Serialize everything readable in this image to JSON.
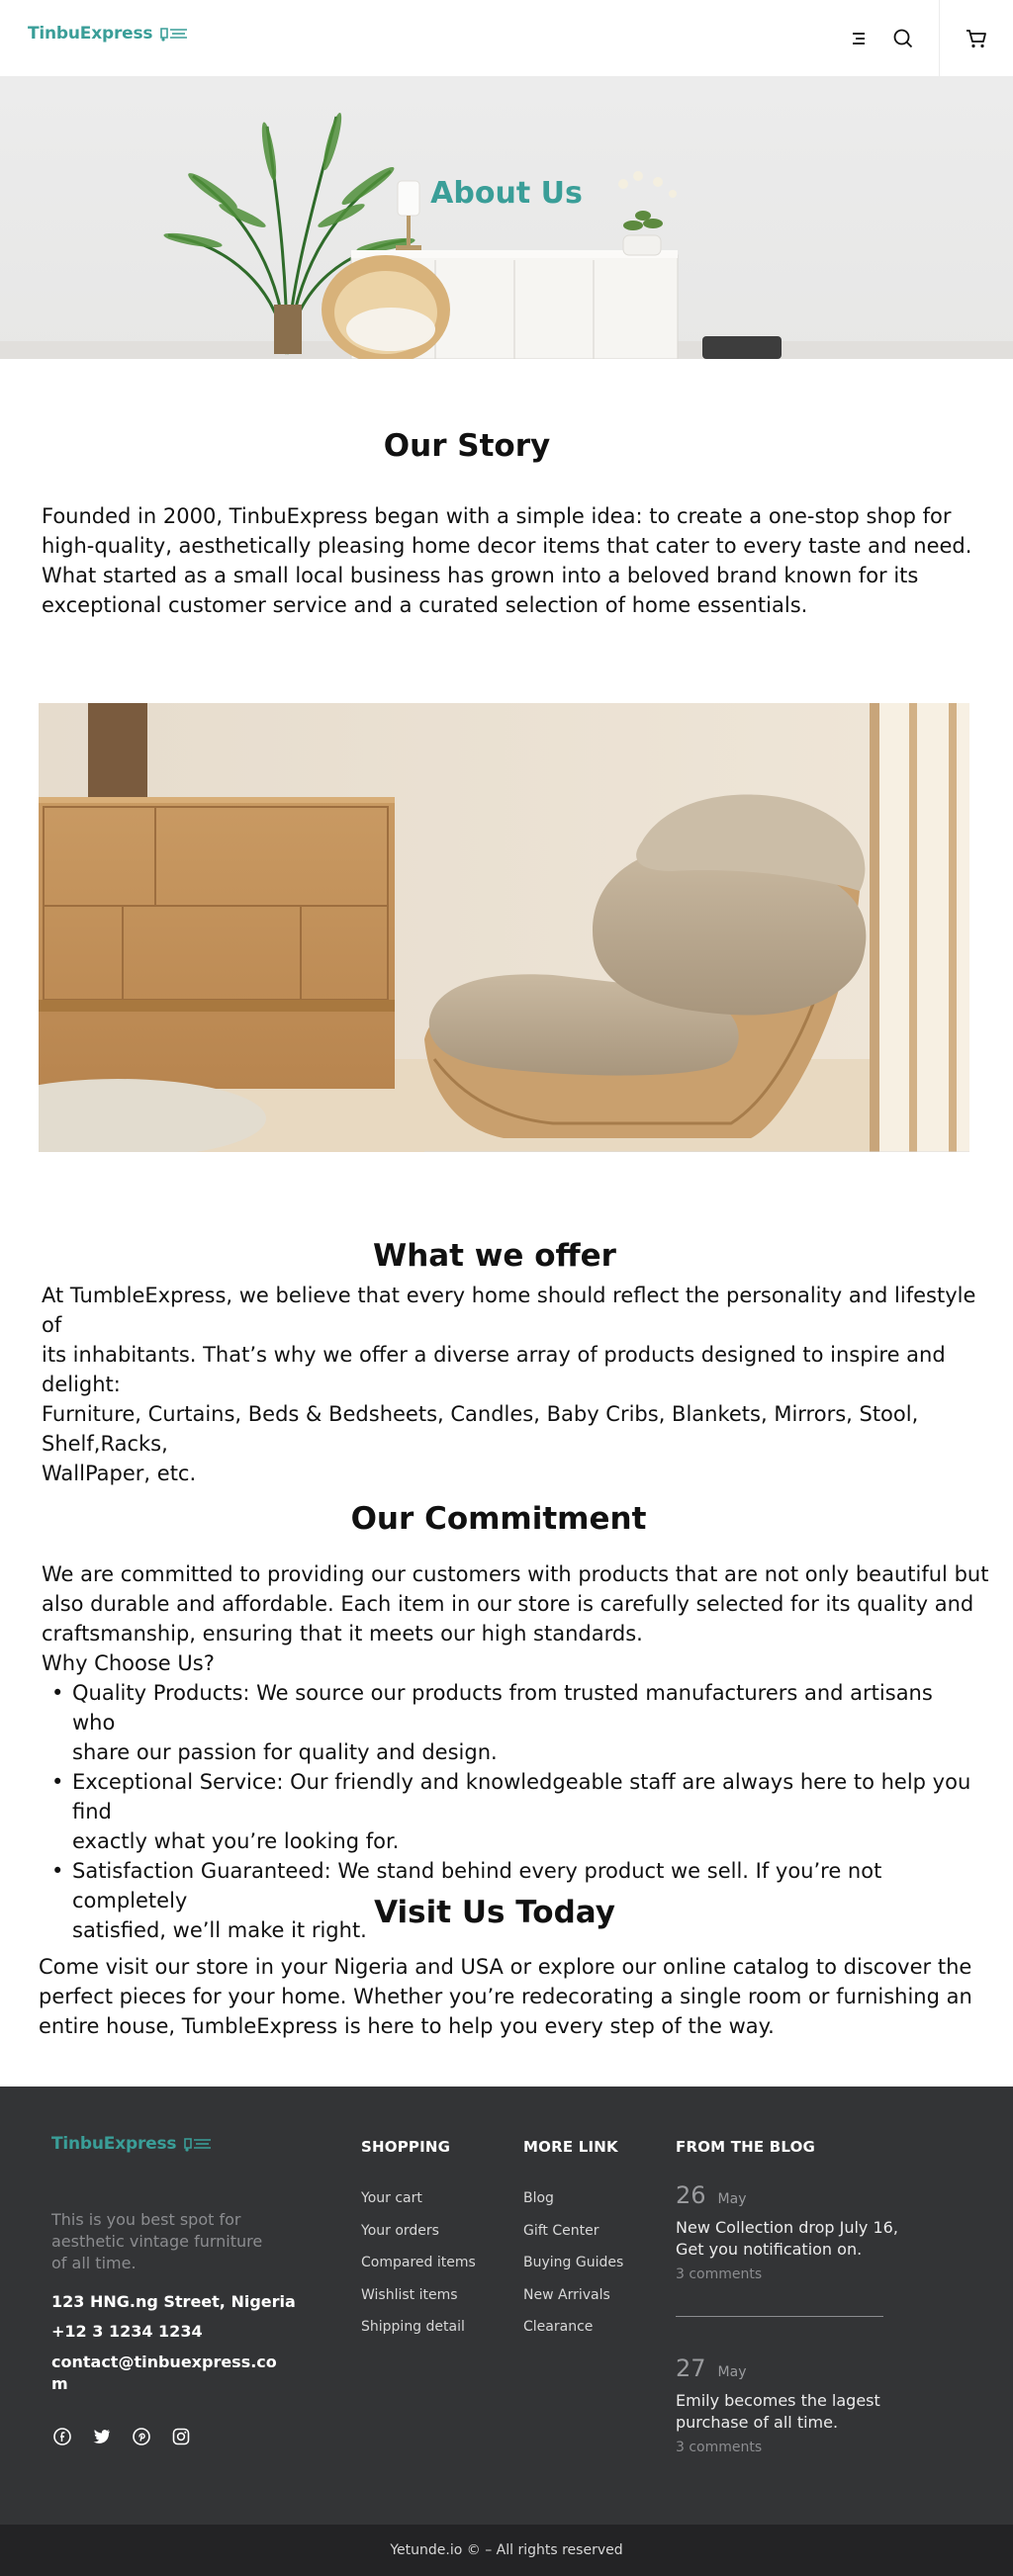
{
  "brand": {
    "name": "TinbuExpress",
    "accent": "#3a9e98"
  },
  "header": {
    "menu_icon": "menu-icon",
    "search_icon": "search-icon",
    "cart_icon": "cart-icon"
  },
  "hero": {
    "title": "About Us"
  },
  "story": {
    "title": "Our Story",
    "lines": [
      "Founded in 2000, TinbuExpress began with a simple idea: to create a one-stop shop for",
      "high-quality, aesthetically pleasing home decor items that cater to every taste and need.",
      "What started as a small local business has grown into a beloved brand known for its",
      "exceptional customer service and a curated selection of home essentials."
    ]
  },
  "offer": {
    "title": "What we offer",
    "lines": [
      "At TumbleExpress, we believe that every home should reflect the personality and lifestyle of",
      "its inhabitants. That’s why we offer a diverse array of products designed to inspire and",
      "delight:",
      "Furniture, Curtains, Beds & Bedsheets, Candles, Baby Cribs, Blankets, Mirrors, Stool, Shelf,Racks,",
      "WallPaper, etc."
    ]
  },
  "commitment": {
    "title": "Our Commitment",
    "lines": [
      "We are committed to providing our customers with products that are not only beautiful but",
      "also durable and affordable. Each item in our store is carefully selected for its quality and",
      "craftsmanship, ensuring that it meets our high standards.",
      "Why Choose Us?"
    ],
    "bullets": [
      [
        "Quality Products: We source our products from trusted manufacturers and artisans who",
        "share our passion for quality and design."
      ],
      [
        "Exceptional Service: Our friendly and knowledgeable staff are always here to help you find",
        "exactly what you’re looking for."
      ],
      [
        "Satisfaction Guaranteed: We stand behind every product we sell. If you’re not completely",
        "satisfied, we’ll make it right."
      ]
    ]
  },
  "visit": {
    "title": "Visit Us Today",
    "lines": [
      "Come visit our store in your Nigeria and USA or explore our online catalog to discover the",
      "perfect pieces for your home. Whether you’re redecorating a single room or furnishing an",
      "entire house, TumbleExpress is here to help you every step of the way."
    ]
  },
  "footer": {
    "tagline": "This is you best spot for aesthetic vintage furniture of all time.",
    "address": "123 HNG.ng Street, Nigeria",
    "phone": "+12 3 1234 1234",
    "email": "contact@tinbuexpress.com",
    "social_icons": [
      "facebook-icon",
      "twitter-icon",
      "pinterest-icon",
      "instagram-icon"
    ],
    "shopping": {
      "title": "SHOPPING",
      "links": [
        "Your cart",
        "Your orders",
        "Compared items",
        "Wishlist items",
        "Shipping detail"
      ]
    },
    "more": {
      "title": "MORE LINK",
      "links": [
        "Blog",
        "Gift Center",
        "Buying Guides",
        "New Arrivals",
        "Clearance"
      ]
    },
    "blog": {
      "title": "FROM THE BLOG",
      "posts": [
        {
          "day": "26",
          "month": "May",
          "text": "New Collection drop July 16, Get you notification on.",
          "comments": "3 comments"
        },
        {
          "day": "27",
          "month": "May",
          "text": "Emily becomes the lagest purchase of all time.",
          "comments": "3 comments"
        }
      ]
    },
    "copyright": "Yetunde.io © – All rights reserved"
  }
}
